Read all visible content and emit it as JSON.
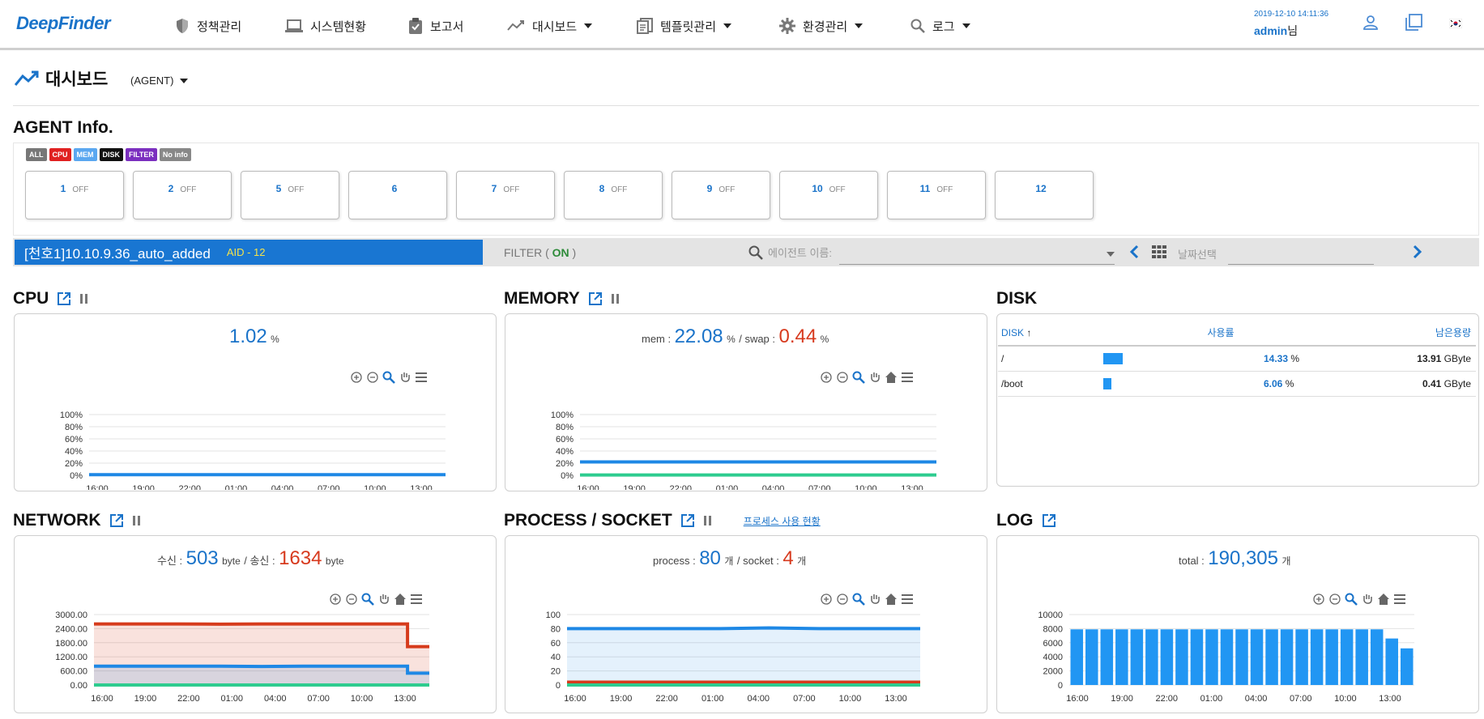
{
  "nav": {
    "logo": "DeepFinder",
    "items": [
      {
        "label": "정책관리",
        "dropdown": false
      },
      {
        "label": "시스템현황",
        "dropdown": false
      },
      {
        "label": "보고서",
        "dropdown": false
      },
      {
        "label": "대시보드",
        "dropdown": true
      },
      {
        "label": "템플릿관리",
        "dropdown": true
      },
      {
        "label": "환경관리",
        "dropdown": true
      },
      {
        "label": "로그",
        "dropdown": true
      }
    ],
    "datetime": "2019-12-10 14:11:36",
    "user": "admin",
    "user_suffix": "님"
  },
  "page": {
    "title": "대시보드",
    "agent_selector": "(AGENT)",
    "agent_info_title": "AGENT Info."
  },
  "legend": [
    {
      "label": "ALL",
      "color": "#777777"
    },
    {
      "label": "CPU",
      "color": "#e02020"
    },
    {
      "label": "MEM",
      "color": "#5aa7f0"
    },
    {
      "label": "DISK",
      "color": "#111111"
    },
    {
      "label": "FILTER",
      "color": "#7b2fbf"
    },
    {
      "label": "No info",
      "color": "#888888"
    }
  ],
  "agents": [
    {
      "id": "1",
      "status": "OFF"
    },
    {
      "id": "2",
      "status": "OFF"
    },
    {
      "id": "5",
      "status": "OFF"
    },
    {
      "id": "6",
      "status": ""
    },
    {
      "id": "7",
      "status": "OFF"
    },
    {
      "id": "8",
      "status": "OFF"
    },
    {
      "id": "9",
      "status": "OFF"
    },
    {
      "id": "10",
      "status": "OFF"
    },
    {
      "id": "11",
      "status": "OFF"
    },
    {
      "id": "12",
      "status": ""
    }
  ],
  "filterbar": {
    "agent_name": "[천호1]10.10.9.36_auto_added",
    "aid": "AID - 12",
    "filter_prefix": "FILTER ( ",
    "filter_state": "ON",
    "filter_suffix": " )",
    "search_placeholder": "에이전트 이름:",
    "date_placeholder": "날짜선택"
  },
  "widgets": {
    "cpu": {
      "title": "CPU",
      "value": "1.02",
      "unit": "%"
    },
    "memory": {
      "title": "MEMORY",
      "mem_label": "mem :",
      "mem_value": "22.08",
      "mem_unit": "%",
      "swap_label": "/ swap :",
      "swap_value": "0.44",
      "swap_unit": "%"
    },
    "disk": {
      "title": "DISK",
      "col_disk": "DISK",
      "col_usage": "사용률",
      "col_free": "남은용량",
      "rows": [
        {
          "mount": "/",
          "pct": "14.33",
          "pct_unit": "%",
          "free": "13.91",
          "free_unit": "GByte",
          "usage": 0.1433
        },
        {
          "mount": "/boot",
          "pct": "6.06",
          "pct_unit": "%",
          "free": "0.41",
          "free_unit": "GByte",
          "usage": 0.0606
        }
      ]
    },
    "network": {
      "title": "NETWORK",
      "rx_label": "수신 :",
      "rx_value": "503",
      "rx_unit": "byte",
      "tx_label": "/ 송신 :",
      "tx_value": "1634",
      "tx_unit": "byte"
    },
    "process": {
      "title": "PROCESS / SOCKET",
      "link": "프로세스 사용 현황",
      "proc_label": "process :",
      "proc_value": "80",
      "proc_unit": "개",
      "sock_label": "/ socket :",
      "sock_value": "4",
      "sock_unit": "개"
    },
    "log": {
      "title": "LOG",
      "total_label": "total :",
      "total_value": "190,305",
      "total_unit": "개"
    }
  },
  "colors": {
    "accent": "#1a73c9",
    "red": "#d73a1e",
    "series_blue": "#1e88e5",
    "series_green": "#2ecc8f",
    "series_red": "#d63b1c"
  },
  "chart_data": [
    {
      "type": "line",
      "title": "CPU",
      "x": [
        "16:00",
        "19:00",
        "22:00",
        "01:00",
        "04:00",
        "07:00",
        "10:00",
        "13:00"
      ],
      "ytick_labels": [
        "0%",
        "20%",
        "40%",
        "60%",
        "80%",
        "100%"
      ],
      "ylim": [
        0,
        100
      ],
      "series": [
        {
          "values": [
            1,
            1,
            1,
            1,
            1,
            1,
            1,
            1
          ],
          "color": "#1e88e5"
        }
      ]
    },
    {
      "type": "line",
      "title": "MEMORY",
      "x": [
        "16:00",
        "19:00",
        "22:00",
        "01:00",
        "04:00",
        "07:00",
        "10:00",
        "13:00"
      ],
      "ytick_labels": [
        "0%",
        "20%",
        "40%",
        "60%",
        "80%",
        "100%"
      ],
      "ylim": [
        0,
        100
      ],
      "series": [
        {
          "values": [
            22,
            22,
            22,
            22,
            22,
            22,
            22,
            22
          ],
          "color": "#1e88e5"
        },
        {
          "values": [
            0.44,
            0.44,
            0.44,
            0.44,
            0.44,
            0.44,
            0.44,
            0.44
          ],
          "color": "#2ecc8f"
        }
      ]
    },
    {
      "type": "area",
      "title": "NETWORK",
      "x": [
        "16:00",
        "19:00",
        "22:00",
        "01:00",
        "04:00",
        "07:00",
        "10:00",
        "13:00"
      ],
      "ytick_labels": [
        "0.00",
        "600.00",
        "1200.00",
        "1800.00",
        "2400.00",
        "3000.00"
      ],
      "ylim": [
        0,
        3000
      ],
      "series": [
        {
          "values": [
            2600,
            2600,
            2600,
            2590,
            2600,
            2600,
            2600,
            2600,
            1634
          ],
          "color": "#d63b1c"
        },
        {
          "values": [
            800,
            800,
            800,
            800,
            790,
            800,
            800,
            800,
            503
          ],
          "color": "#1e88e5"
        },
        {
          "values": [
            0,
            0,
            0,
            0,
            0,
            0,
            0,
            0,
            0
          ],
          "color": "#2ecc8f"
        }
      ]
    },
    {
      "type": "area",
      "title": "PROCESS / SOCKET",
      "x": [
        "16:00",
        "19:00",
        "22:00",
        "01:00",
        "04:00",
        "07:00",
        "10:00",
        "13:00"
      ],
      "ytick_labels": [
        "0",
        "20",
        "40",
        "60",
        "80",
        "100"
      ],
      "ylim": [
        0,
        100
      ],
      "series": [
        {
          "values": [
            80,
            80,
            80,
            80,
            81,
            80,
            80,
            80
          ],
          "color": "#1e88e5"
        },
        {
          "values": [
            4,
            4,
            4,
            4,
            4,
            4,
            4,
            4
          ],
          "color": "#d63b1c"
        },
        {
          "values": [
            0,
            0,
            0,
            0,
            0,
            0,
            0,
            0
          ],
          "color": "#2ecc8f"
        }
      ]
    },
    {
      "type": "bar",
      "title": "LOG",
      "x": [
        "16:00",
        "19:00",
        "22:00",
        "01:00",
        "04:00",
        "07:00",
        "10:00",
        "13:00"
      ],
      "ytick_labels": [
        "0",
        "2000",
        "4000",
        "6000",
        "8000",
        "10000"
      ],
      "ylim": [
        0,
        10000
      ],
      "values": [
        7900,
        7900,
        7900,
        7900,
        7900,
        7900,
        7900,
        7900,
        7900,
        7900,
        7900,
        7900,
        7900,
        7900,
        7900,
        7900,
        7900,
        7900,
        7900,
        7900,
        7900,
        6600,
        5200
      ],
      "color": "#2196f3"
    }
  ]
}
